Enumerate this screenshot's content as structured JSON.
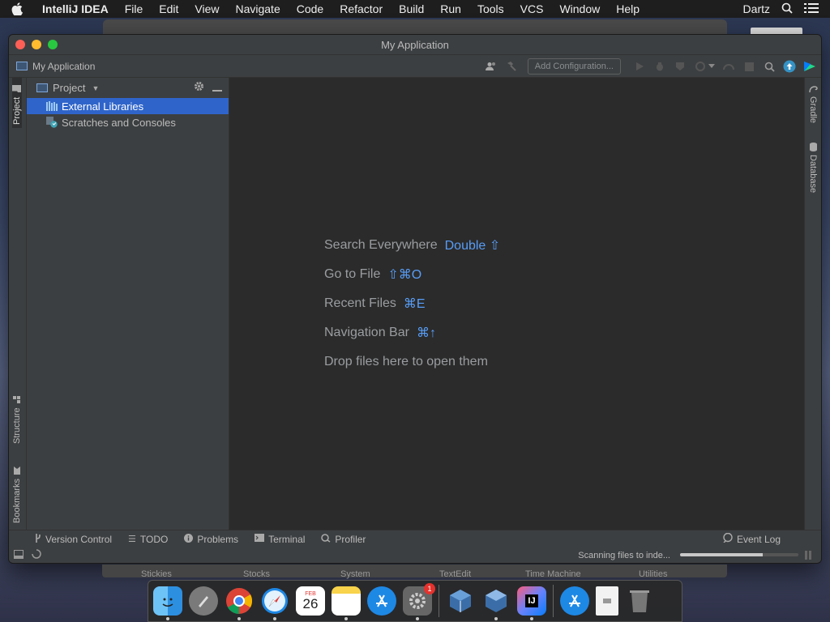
{
  "menubar": {
    "app_name": "IntelliJ IDEA",
    "items": [
      "File",
      "Edit",
      "View",
      "Navigate",
      "Code",
      "Refactor",
      "Build",
      "Run",
      "Tools",
      "VCS",
      "Window",
      "Help"
    ],
    "user": "Dartz"
  },
  "window": {
    "title": "My Application"
  },
  "navbar": {
    "project_name": "My Application",
    "add_configuration": "Add Configuration..."
  },
  "left_strip": {
    "project_tab": "Project",
    "structure_tab": "Structure",
    "bookmarks_tab": "Bookmarks"
  },
  "right_strip": {
    "gradle_tab": "Gradle",
    "database_tab": "Database"
  },
  "project_panel": {
    "title": "Project",
    "tree": [
      {
        "label": "External Libraries",
        "selected": true,
        "icon": "library-icon"
      },
      {
        "label": "Scratches and Consoles",
        "selected": false,
        "icon": "scratches-icon"
      }
    ]
  },
  "editor": {
    "hints": [
      {
        "text": "Search Everywhere",
        "key": "Double ⇧"
      },
      {
        "text": "Go to File",
        "key": "⇧⌘O"
      },
      {
        "text": "Recent Files",
        "key": "⌘E"
      },
      {
        "text": "Navigation Bar",
        "key": "⌘↑"
      },
      {
        "text": "Drop files here to open them",
        "key": ""
      }
    ]
  },
  "bottom_tabs": {
    "version_control": "Version Control",
    "todo": "TODO",
    "problems": "Problems",
    "terminal": "Terminal",
    "profiler": "Profiler",
    "event_log": "Event Log"
  },
  "status": {
    "text": "Scanning files to inde...",
    "progress": 0.7
  },
  "dock_peek": {
    "labels": [
      "Stickies",
      "Stocks",
      "System",
      "TextEdit",
      "Time Machine",
      "Utilities"
    ]
  },
  "dock": {
    "calendar_month": "FEB",
    "calendar_day": "26",
    "settings_badge": "1",
    "ij_label": "IJ"
  },
  "colors": {
    "accent": "#589df6",
    "selection": "#2f65ca",
    "background": "#2b2b2b",
    "panel": "#3c3f41"
  }
}
